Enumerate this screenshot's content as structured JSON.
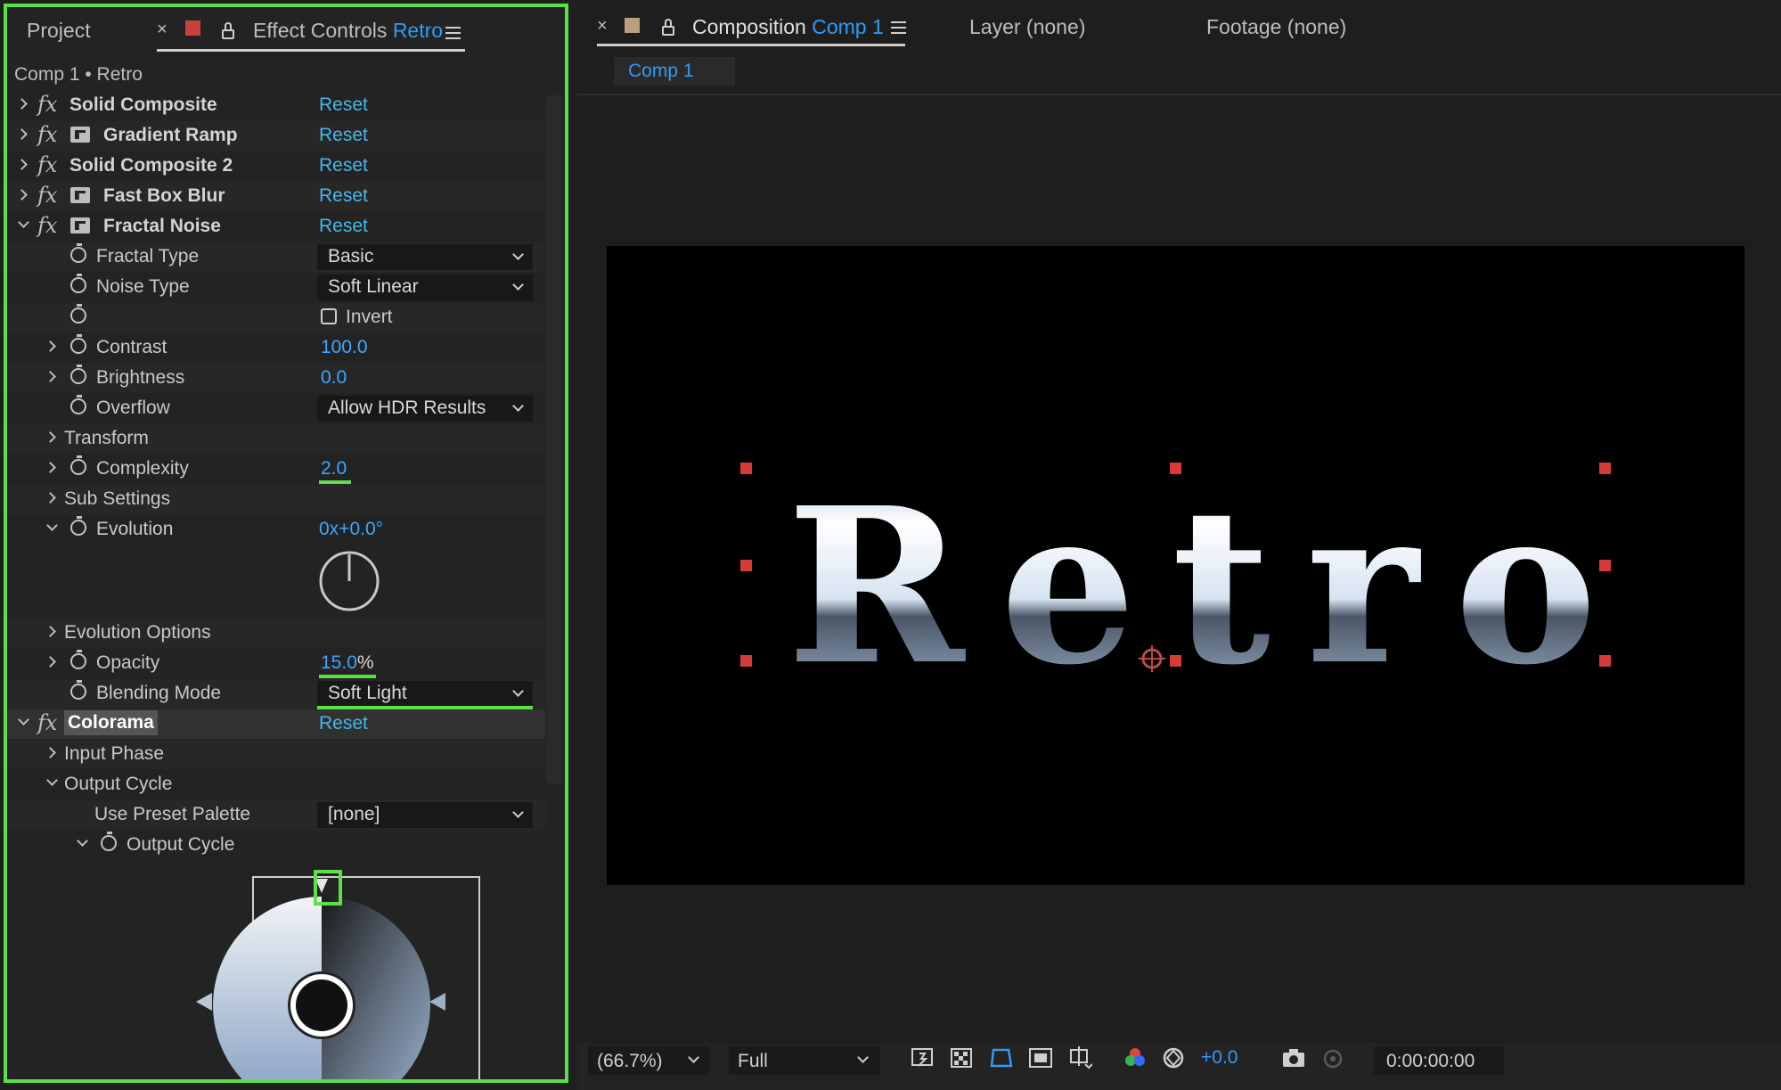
{
  "effect_panel": {
    "tabs": {
      "project": "Project",
      "effect_controls_prefix": "Effect Controls",
      "effect_controls_layer": "Retro"
    },
    "breadcrumb": "Comp 1 • Retro",
    "effects": [
      {
        "name": "Solid Composite",
        "reset": "Reset"
      },
      {
        "name": "Gradient Ramp",
        "reset": "Reset"
      },
      {
        "name": "Solid Composite 2",
        "reset": "Reset"
      },
      {
        "name": "Fast Box Blur",
        "reset": "Reset"
      },
      {
        "name": "Fractal Noise",
        "reset": "Reset"
      }
    ],
    "fractal_noise": {
      "fractal_type": {
        "label": "Fractal Type",
        "value": "Basic"
      },
      "noise_type": {
        "label": "Noise Type",
        "value": "Soft Linear"
      },
      "invert": {
        "label": "Invert"
      },
      "contrast": {
        "label": "Contrast",
        "value": "100.0"
      },
      "brightness": {
        "label": "Brightness",
        "value": "0.0"
      },
      "overflow": {
        "label": "Overflow",
        "value": "Allow HDR Results"
      },
      "transform": {
        "label": "Transform"
      },
      "complexity": {
        "label": "Complexity",
        "value": "2.0"
      },
      "sub_settings": {
        "label": "Sub Settings"
      },
      "evolution": {
        "label": "Evolution",
        "value": "0x+0.0°"
      },
      "evolution_options": {
        "label": "Evolution Options"
      },
      "opacity": {
        "label": "Opacity",
        "value": "15.0",
        "unit": "%"
      },
      "blending_mode": {
        "label": "Blending Mode",
        "value": "Soft Light"
      }
    },
    "colorama": {
      "name": "Colorama",
      "reset": "Reset",
      "input_phase": "Input Phase",
      "output_cycle_group": "Output Cycle",
      "use_preset_palette": {
        "label": "Use Preset Palette",
        "value": "[none]"
      },
      "output_cycle": "Output Cycle"
    }
  },
  "composition_panel": {
    "tabs": {
      "composition_prefix": "Composition",
      "composition_name": "Comp 1",
      "layer": "Layer (none)",
      "footage": "Footage (none)"
    },
    "comp_chip": "Comp 1",
    "viewer_text": "Retro",
    "bottom_bar": {
      "zoom": "(66.7%)",
      "resolution": "Full",
      "exposure": "+0.0",
      "timecode": "0:00:00:00"
    }
  },
  "colors": {
    "highlight_green": "#5ddf4a",
    "link_blue": "#2f9bf7",
    "reset_blue": "#45b7ea",
    "handle_red": "#d63b3b",
    "label_swatch_red": "#c94040",
    "label_swatch_tan": "#b8a07c"
  }
}
